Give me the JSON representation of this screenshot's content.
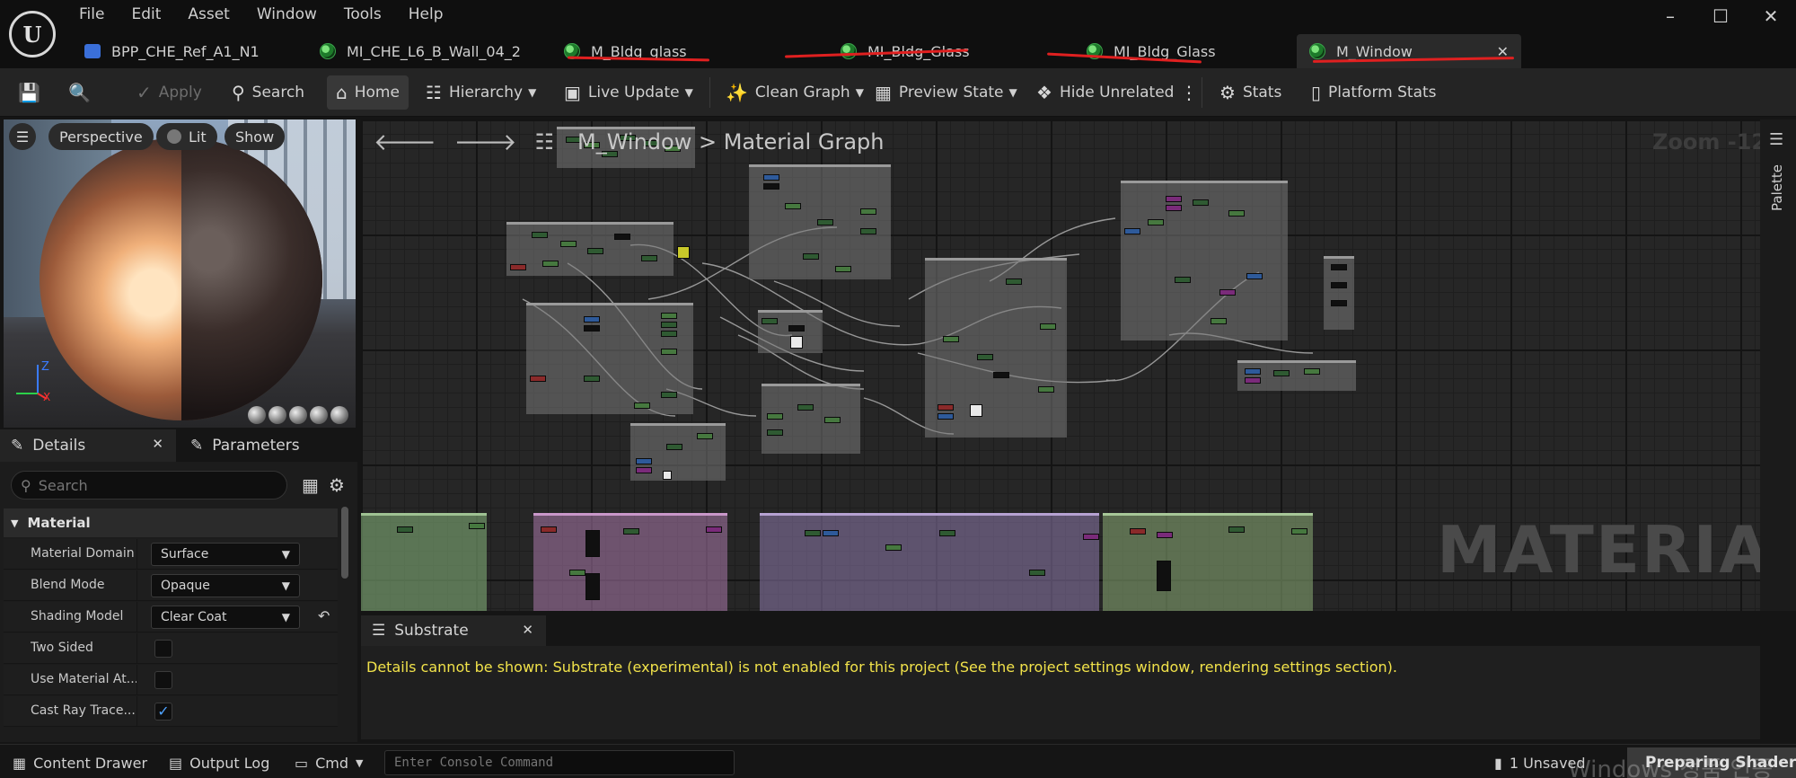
{
  "menu": [
    "File",
    "Edit",
    "Asset",
    "Window",
    "Tools",
    "Help"
  ],
  "tabs": [
    {
      "label": "BPP_CHE_Ref_A1_N1",
      "icon": "blueprint-icon"
    },
    {
      "label": "MI_CHE_L6_B_Wall_04_2",
      "icon": "material-instance-icon"
    },
    {
      "label": "M_Bldg_glass",
      "icon": "material-icon"
    },
    {
      "label": "MI_Bldg_Glass",
      "icon": "material-instance-icon"
    },
    {
      "label": "MI_Bldg_Glass",
      "icon": "material-instance-icon"
    },
    {
      "label": "M_Window",
      "icon": "material-icon",
      "active": true
    }
  ],
  "toolbar": {
    "apply": "Apply",
    "search": "Search",
    "home": "Home",
    "hierarchy": "Hierarchy",
    "live_update": "Live Update",
    "clean_graph": "Clean Graph",
    "preview_state": "Preview State",
    "hide_unrelated": "Hide Unrelated",
    "stats": "Stats",
    "platform_stats": "Platform Stats"
  },
  "viewport": {
    "perspective": "Perspective",
    "lit": "Lit",
    "show": "Show",
    "axis_x": "X",
    "axis_z": "Z"
  },
  "panels": {
    "details": "Details",
    "parameters": "Parameters",
    "search_placeholder": "Search"
  },
  "details": {
    "category": "Material",
    "rows": [
      {
        "label": "Material Domain",
        "value": "Surface",
        "type": "combo"
      },
      {
        "label": "Blend Mode",
        "value": "Opaque",
        "type": "combo"
      },
      {
        "label": "Shading Model",
        "value": "Clear Coat",
        "type": "combo",
        "reset": true
      },
      {
        "label": "Two Sided",
        "type": "checkbox",
        "checked": false
      },
      {
        "label": "Use Material At...",
        "type": "checkbox",
        "checked": false
      },
      {
        "label": "Cast Ray Trace...",
        "type": "checkbox",
        "checked": true
      }
    ]
  },
  "graph": {
    "breadcrumb_root": "M_Window",
    "breadcrumb_sep": ">",
    "breadcrumb_leaf": "Material Graph",
    "zoom": "Zoom -12",
    "watermark": "MATERIAL",
    "palette": "Palette"
  },
  "substrate": {
    "tab": "Substrate",
    "message": "Details cannot be shown: Substrate (experimental) is not enabled for this project (See the project settings window, rendering settings section)."
  },
  "statusbar": {
    "content_drawer": "Content Drawer",
    "output_log": "Output Log",
    "cmd": "Cmd",
    "console_placeholder": "Enter Console Command",
    "unsaved": "1 Unsaved",
    "preparing": "Preparing Shaders",
    "os_watermark": "Windows 정품 인증"
  },
  "colors": {
    "accent_red_marks": "#e02020",
    "warning_text": "#f1e24a",
    "checkbox_accent": "#4fa3ff"
  }
}
